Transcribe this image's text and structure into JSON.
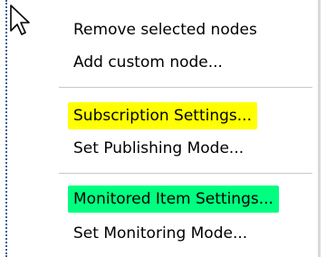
{
  "menu": {
    "items": [
      {
        "label": "Remove selected nodes",
        "highlight": null
      },
      {
        "label": "Add custom node...",
        "highlight": null
      },
      {
        "label": "Subscription Settings...",
        "highlight": "#ffff00"
      },
      {
        "label": "Set Publishing Mode...",
        "highlight": null
      },
      {
        "label": "Monitored Item Settings...",
        "highlight": "#00ff80"
      },
      {
        "label": "Set Monitoring Mode...",
        "highlight": null
      }
    ]
  },
  "colors": {
    "highlight_yellow": "#ffff00",
    "highlight_green": "#00ff80",
    "separator": "#c8c8c8"
  },
  "icons": {
    "cursor": "mouse-pointer-icon"
  }
}
